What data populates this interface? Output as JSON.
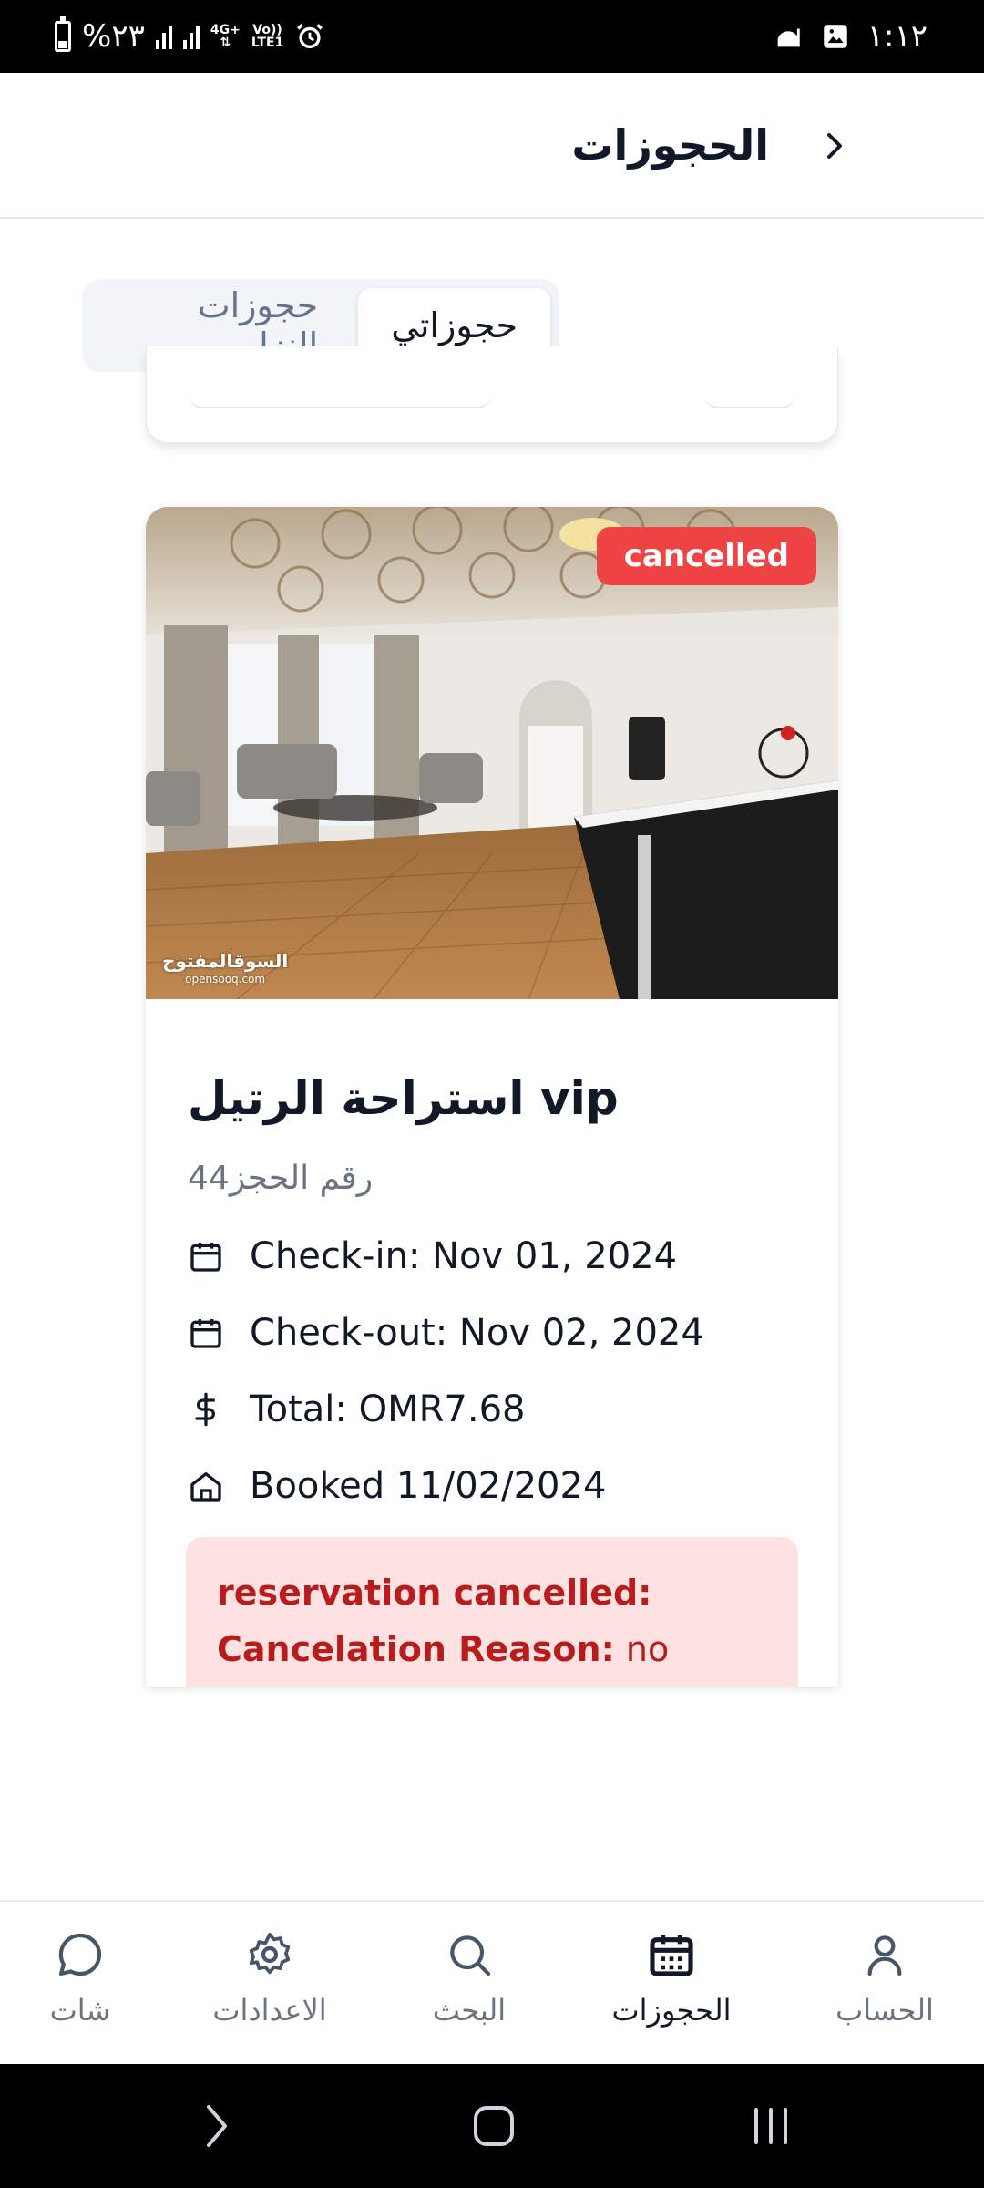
{
  "status_bar": {
    "battery_percent": "%٢٣",
    "network_top": "4G+",
    "volte": "Vo))",
    "lte": "LTE1",
    "time": "١:١٢"
  },
  "header": {
    "title": "الحجوزات"
  },
  "tabs": [
    {
      "label": "حجوزاتي",
      "active": true
    },
    {
      "label": "حجوزات النزل",
      "active": false
    }
  ],
  "booking": {
    "status": "cancelled",
    "watermark_ar": "السوقالمفتوح",
    "watermark_en": "opensooq.com",
    "title": "استراحة الرتيل vip",
    "booking_number": "رقم الحجز44",
    "check_in": "Check-in: Nov 01, 2024",
    "check_out": "Check-out: Nov 02, 2024",
    "total": "Total: OMR7.68",
    "booked": "Booked 11/02/2024",
    "cancel_heading": "reservation cancelled:",
    "cancel_reason_label": "Cancelation Reason:",
    "cancel_reason_value": "no reason"
  },
  "bottom_nav": [
    {
      "label": "الحساب",
      "icon": "user-icon",
      "active": false
    },
    {
      "label": "الحجوزات",
      "icon": "calendar-icon",
      "active": true
    },
    {
      "label": "البحث",
      "icon": "search-icon",
      "active": false
    },
    {
      "label": "الاعدادات",
      "icon": "gear-icon",
      "active": false
    },
    {
      "label": "شات",
      "icon": "chat-icon",
      "active": false
    }
  ],
  "colors": {
    "badge": "#ef4444",
    "cancel_bg": "#fee2e2",
    "cancel_text": "#b91c1c",
    "muted": "#6b7280"
  }
}
